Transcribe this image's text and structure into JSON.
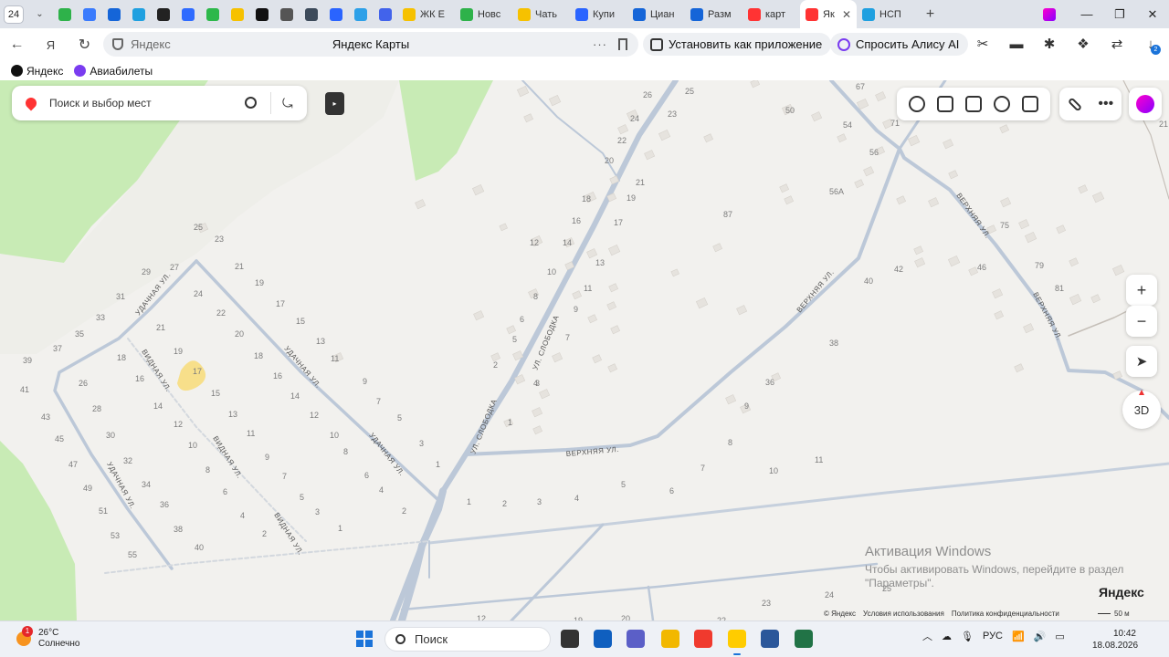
{
  "browser": {
    "tab_counter": "24",
    "tabs": [
      {
        "title": "",
        "color": "#2eb24a"
      },
      {
        "title": "",
        "color": "#3a7bfd"
      },
      {
        "title": "",
        "color": "#1565d8"
      },
      {
        "title": "",
        "color": "#1fa0e0"
      },
      {
        "title": "",
        "color": "#222222"
      },
      {
        "title": "",
        "color": "#2f6bff"
      },
      {
        "title": "",
        "color": "#2db84b"
      },
      {
        "title": "",
        "color": "#f6c100"
      },
      {
        "title": "",
        "color": "#111111"
      },
      {
        "title": "",
        "color": "#555555"
      },
      {
        "title": "",
        "color": "#3c4a5a"
      },
      {
        "title": "",
        "color": "#2a64ff"
      },
      {
        "title": "",
        "color": "#2da0e8"
      },
      {
        "title": "",
        "color": "#4263eb"
      }
    ],
    "named_tabs": [
      {
        "title": "ЖК Е",
        "color": "#f6c100"
      },
      {
        "title": "Новс",
        "color": "#2eb24a"
      },
      {
        "title": "Чать",
        "color": "#f6c100"
      },
      {
        "title": "Купи",
        "color": "#2a64ff"
      },
      {
        "title": "Циан",
        "color": "#1565d8"
      },
      {
        "title": "Разм",
        "color": "#1565d8"
      },
      {
        "title": "карт",
        "color": "#f33"
      }
    ],
    "active_tab": {
      "title": "Як",
      "color": "#f33"
    },
    "after_tab": {
      "title": "НСП",
      "color": "#1fa0e0"
    },
    "new_tab_label": "+",
    "window_controls": [
      "—",
      "❐",
      "✕"
    ],
    "address": {
      "host": "Яндекс",
      "page_title": "Яндекс Карты",
      "menu": "···"
    },
    "install_app_label": "Установить как приложение",
    "ask_alice_label": "Спросить Алису AI",
    "downloads_badge": "2",
    "bookmarks": [
      {
        "label": "Яндекс",
        "color": "#111111"
      },
      {
        "label": "Авиабилеты",
        "color": "#7a3cf0"
      }
    ]
  },
  "map": {
    "search_placeholder": "Поиск и выбор мест",
    "zoom_in": "+",
    "zoom_out": "−",
    "btn_3d": "3D",
    "streets": {
      "udachnaya_1": "УДАЧНАЯ УЛ.",
      "udachnaya_2": "УДАЧНАЯ УЛ.",
      "udachnaya_3": "УДАЧНАЯ УЛ.",
      "udachnaya_4": "УДАЧНАЯ УЛ.",
      "vidnaya_1": "ВИДНАЯ УЛ.",
      "vidnaya_2": "ВИДНАЯ УЛ.",
      "vidnaya_3": "ВИДНАЯ УЛ.",
      "sloboda_1": "УЛ. СЛОБОДКА",
      "sloboda_2": "УЛ. СЛОБОДКА",
      "verkhnyaya_1": "ВЕРХНЯЯ УЛ.",
      "verkhnyaya_2": "ВЕРХНЯЯ УЛ.",
      "verkhnyaya_3": "ВЕРХНЯЯ УЛ.",
      "verkhnyaya_4": "ВЕРХНЯЯ УЛ."
    },
    "house_numbers": [
      "26",
      "25",
      "24",
      "23",
      "22",
      "20",
      "21",
      "19",
      "18",
      "17",
      "16",
      "14",
      "12",
      "13",
      "10",
      "11",
      "9",
      "8",
      "7",
      "6",
      "5",
      "4",
      "3",
      "2",
      "1",
      "50",
      "54",
      "56",
      "56А",
      "71",
      "67",
      "21",
      "75",
      "87",
      "79",
      "81",
      "46",
      "42",
      "40",
      "38",
      "36",
      "9",
      "8",
      "7",
      "10",
      "11",
      "25",
      "23",
      "29",
      "27",
      "21",
      "19",
      "17",
      "15",
      "13",
      "11",
      "9",
      "7",
      "5",
      "3",
      "1",
      "31",
      "24",
      "22",
      "20",
      "18",
      "16",
      "14",
      "12",
      "10",
      "8",
      "6",
      "4",
      "2",
      "33",
      "35",
      "21",
      "19",
      "18",
      "17",
      "16",
      "15",
      "14",
      "13",
      "12",
      "11",
      "10",
      "9",
      "8",
      "7",
      "6",
      "5",
      "4",
      "3",
      "2",
      "1",
      "37",
      "39",
      "26",
      "28",
      "30",
      "32",
      "34",
      "36",
      "38",
      "40",
      "41",
      "43",
      "45",
      "47",
      "49",
      "51",
      "53",
      "55",
      "1",
      "2",
      "3",
      "4",
      "5",
      "6",
      "24",
      "23",
      "12",
      "19",
      "20",
      "22",
      "25"
    ],
    "activation": {
      "title": "Активация Windows",
      "line1": "Чтобы активировать Windows, перейдите в раздел",
      "line2": "\"Параметры\"."
    },
    "brand": "Яндекс",
    "copyright": "© Яндекс",
    "terms": "Условия использования",
    "privacy": "Политика конфиденциальности",
    "scale_label": "50 м"
  },
  "taskbar": {
    "weather_badge": "1",
    "temperature": "26°C",
    "weather_text": "Солнечно",
    "search_label": "Поиск",
    "apps": [
      {
        "name": "task-view",
        "color": "#333333"
      },
      {
        "name": "store",
        "color": "#0f5fbf"
      },
      {
        "name": "teams",
        "color": "#5b5fc7"
      },
      {
        "name": "explorer",
        "color": "#f2b800"
      },
      {
        "name": "yandex",
        "color": "#f03a2e"
      },
      {
        "name": "yandex-browser",
        "color": "#ffcc00"
      },
      {
        "name": "word",
        "color": "#2b579a"
      },
      {
        "name": "excel",
        "color": "#217346"
      }
    ],
    "lang": "РУС",
    "time": "10:42",
    "date": "18.08.2026"
  }
}
